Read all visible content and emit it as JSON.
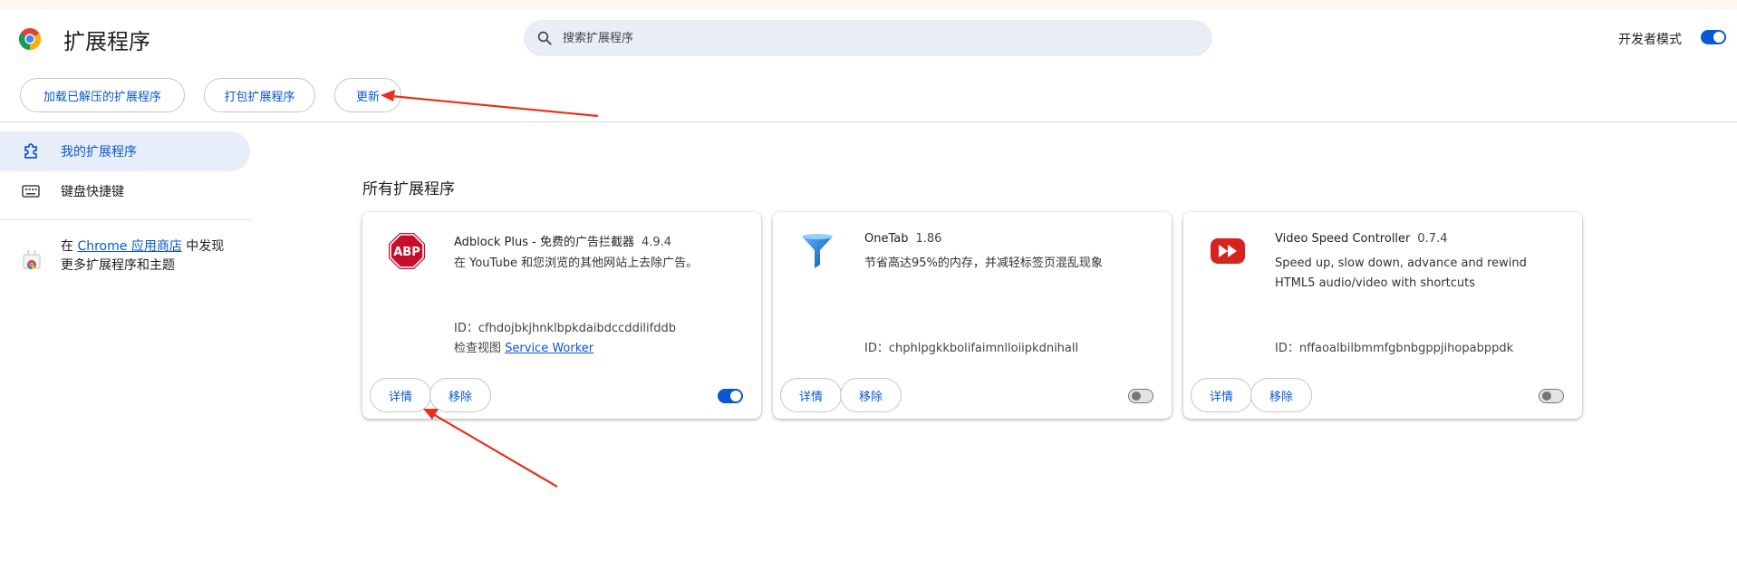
{
  "header": {
    "title": "扩展程序",
    "search_placeholder": "搜索扩展程序",
    "developer_mode_label": "开发者模式",
    "developer_mode_on": true
  },
  "toolbar": {
    "load_unpacked": "加载已解压的扩展程序",
    "pack_extension": "打包扩展程序",
    "update": "更新"
  },
  "sidebar": {
    "items": [
      {
        "label": "我的扩展程序",
        "icon": "puzzle-icon",
        "active": true
      },
      {
        "label": "键盘快捷键",
        "icon": "keyboard-icon",
        "active": false
      }
    ],
    "store": {
      "prefix": "在 ",
      "link": "Chrome 应用商店",
      "suffix_line1": " 中发现",
      "line2": "更多扩展程序和主题"
    }
  },
  "main": {
    "section_title": "所有扩展程序",
    "extensions": [
      {
        "name": "Adblock Plus - 免费的广告拦截器",
        "version": "4.9.4",
        "description": "在 YouTube 和您浏览的其他网站上去除广告。",
        "id_label": "ID：",
        "id": "cfhdojbkjhnklbpkdaibdccddilifddb",
        "inspect_label": "检查视图",
        "inspect_link": "Service Worker",
        "details": "详情",
        "remove": "移除",
        "enabled": true,
        "icon": "abp-icon"
      },
      {
        "name": "OneTab",
        "version": "1.86",
        "description": "节省高达95%的内存，并减轻标签页混乱现象",
        "id_label": "ID：",
        "id": "chphlpgkkbolifaimnlloiipkdnihall",
        "details": "详情",
        "remove": "移除",
        "enabled": false,
        "icon": "funnel-icon"
      },
      {
        "name": "Video Speed Controller",
        "version": "0.7.4",
        "description": "Speed up, slow down, advance and rewind HTML5 audio/video with shortcuts",
        "id_label": "ID：",
        "id": "nffaoalbilbmmfgbnbgppjihopabppdk",
        "details": "详情",
        "remove": "移除",
        "enabled": false,
        "icon": "fast-forward-icon"
      }
    ]
  },
  "colors": {
    "accent": "#0b57d0",
    "active_bg": "#e8eef9",
    "search_bg": "#e9eef6",
    "annotation_arrow": "#e8301c"
  }
}
